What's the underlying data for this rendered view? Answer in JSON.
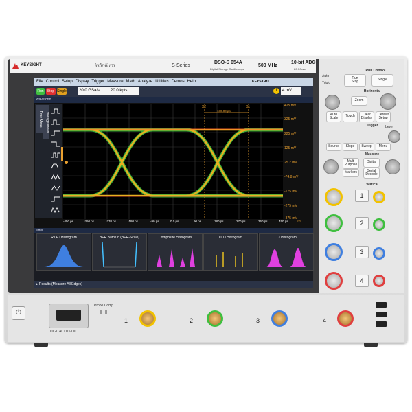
{
  "header": {
    "brand": "KEYSIGHT",
    "product_line": "infiniium",
    "series": "S-Series",
    "model": "DSO-S 054A",
    "model_sub": "Digital Storage Oscilloscope",
    "bandwidth": "500 MHz",
    "adc": "10-bit ADC",
    "sample_rate_sub": "20 GSa/s"
  },
  "screen": {
    "menu": [
      "File",
      "Control",
      "Setup",
      "Display",
      "Trigger",
      "Measure",
      "Math",
      "Analyze",
      "Utilities",
      "Demos",
      "Help"
    ],
    "menu_brand": "KEYSIGHT",
    "run_label": "Run",
    "stop_label": "Stop",
    "single_label": "Single",
    "sample_rate": "20.0 GSa/s",
    "memory_depth": "20.0 kpts",
    "trigger_level": "4 mV",
    "waveform_title": "Waveform",
    "side_tabs": [
      "Time Meas",
      "Voltage Meas"
    ],
    "cursor_x1": "X1",
    "cursor_x2": "X2",
    "cursor_delta": "180.00 ps",
    "y_labels": [
      "425 mV",
      "325 mV",
      "225 mV",
      "125 mV",
      "25.2 mV",
      "-74.8 mV",
      "-175 mV",
      "-275 mV",
      "-375 mV"
    ],
    "x_labels": [
      "-450 ps",
      "-360 ps",
      "-270 ps",
      "-180 ps",
      "-90 ps",
      "0.0 ps",
      "90 ps",
      "180 ps",
      "270 ps",
      "360 ps",
      "450 ps"
    ],
    "x_unit": "m1",
    "jitter_title": "Jitter",
    "histograms": [
      "RJ,PJ Histogram",
      "BER Bathtub (BER-Scale)",
      "Composite Histogram",
      "DDJ Histogram",
      "TJ Histogram"
    ],
    "results_label": "Results",
    "results_detail": "(Measure All Edges)"
  },
  "panel": {
    "run_control": "Run Control",
    "auto": "Auto",
    "trig_d": "Trig'd",
    "run_stop": "Run\nStop",
    "single": "Single",
    "horizontal": "Horizontal",
    "zoom": "Zoom",
    "auto_scale": "Auto\nScale",
    "touch": "Touch",
    "clear_display": "Clear\nDisplay",
    "default_setup": "Default\nSetup",
    "trigger": "Trigger",
    "level": "Level",
    "source": "Source",
    "slope": "Slope",
    "sweep": "Sweep",
    "menu": "Menu",
    "measure": "Measure",
    "multi_purpose": "Multi\nPurpose",
    "digital": "Digital",
    "markers": "Markers",
    "serial_decode": "Serial\nDecode",
    "vertical": "Vertical",
    "channels": [
      "1",
      "2",
      "3",
      "4"
    ]
  },
  "lower": {
    "digital": "DIGITAL D15-D0",
    "probe_comp": "Probe Comp",
    "inputs": [
      "1",
      "2",
      "3",
      "4"
    ]
  },
  "colors": {
    "ch1": "#f2c200",
    "ch2": "#3fbf3f",
    "ch3": "#3f7fe0",
    "ch4": "#e03f3f",
    "eye": "#e8b020",
    "cursor": "#e8a030"
  }
}
